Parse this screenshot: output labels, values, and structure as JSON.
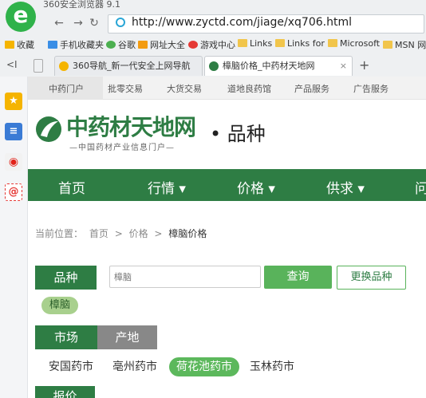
{
  "browser": {
    "title": "360安全浏览器 9.1",
    "address": "http://www.zyctd.com/jiage/xq706.html",
    "bookmarks": [
      "收藏",
      "手机收藏夹",
      "谷歌",
      "网址大全",
      "游戏中心",
      "Links",
      "Links for",
      "Microsoft",
      "MSN 网"
    ],
    "tabs": [
      {
        "label": "360导航_新一代安全上网导航",
        "active": false
      },
      {
        "label": "樟脑价格_中药材天地网",
        "active": true
      }
    ],
    "new_tab": "+",
    "back_arrow": "<I"
  },
  "site": {
    "top_nav": [
      "中药门户",
      "批零交易",
      "大货交易",
      "道地良药馆",
      "产品服务",
      "广告服务"
    ],
    "logo_text": "中药材天地网",
    "logo_sub": "—中国药材产业信息门户—",
    "page_title": "• 品种",
    "main_nav": [
      "首页",
      "行情 ▾",
      "价格 ▾",
      "供求 ▾",
      "问"
    ],
    "breadcrumb": [
      "当前位置：",
      "首页",
      ">",
      "价格",
      ">",
      "樟脑价格"
    ],
    "variety_label": "品种",
    "search_placeholder": "樟脑",
    "query_button": "查询",
    "change_button": "更换品种",
    "selected_variety": "樟脑",
    "filter_tabs": [
      "市场",
      "产地"
    ],
    "markets": [
      "安国药市",
      "亳州药市",
      "荷花池药市",
      "玉林药市"
    ],
    "price_label": "报价"
  },
  "colors": {
    "brand_green": "#2e7d44",
    "button_green": "#59b35b"
  }
}
